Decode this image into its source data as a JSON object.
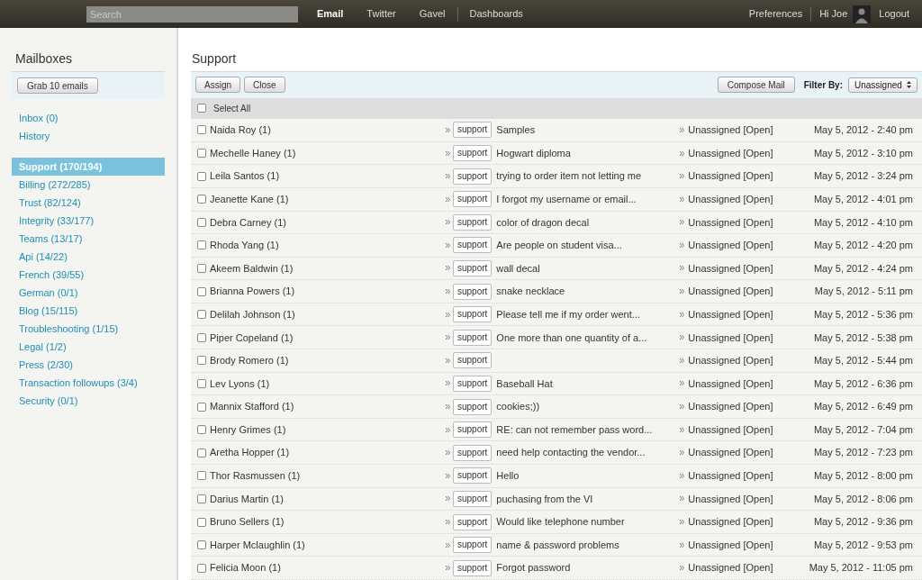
{
  "topbar": {
    "search": {
      "placeholder": "Search"
    },
    "nav": [
      {
        "label": "Email",
        "selected": true
      },
      {
        "label": "Twitter",
        "selected": false
      },
      {
        "label": "Gavel",
        "selected": false
      },
      {
        "label": "Dashboards",
        "selected": false
      }
    ],
    "preferences": "Preferences",
    "greeting": "Hi Joe",
    "logout": "Logout"
  },
  "sidebar": {
    "title": "Mailboxes",
    "grab_button": "Grab 10 emails",
    "top_items": [
      {
        "label": "Inbox (0)"
      },
      {
        "label": "History"
      }
    ],
    "mailboxes": [
      {
        "label": "Support (170/194)",
        "selected": true
      },
      {
        "label": "Billing (272/285)",
        "selected": false
      },
      {
        "label": "Trust (82/124)",
        "selected": false
      },
      {
        "label": "Integrity (33/177)",
        "selected": false
      },
      {
        "label": "Teams (13/17)",
        "selected": false
      },
      {
        "label": "Api (14/22)",
        "selected": false
      },
      {
        "label": "French (39/55)",
        "selected": false
      },
      {
        "label": "German (0/1)",
        "selected": false
      },
      {
        "label": "Blog (15/115)",
        "selected": false
      },
      {
        "label": "Troubleshooting (1/15)",
        "selected": false
      },
      {
        "label": "Legal (1/2)",
        "selected": false
      },
      {
        "label": "Press (2/30)",
        "selected": false
      },
      {
        "label": "Transaction followups (3/4)",
        "selected": false
      },
      {
        "label": "Security (0/1)",
        "selected": false
      }
    ]
  },
  "main": {
    "title": "Support",
    "buttons": [
      "Assign",
      "Close"
    ],
    "compose_button": "Compose Mail",
    "filter_label": "Filter By:",
    "filter_value": "Unassigned",
    "select_all": {
      "label": "Select All",
      "checked": false
    },
    "rows": [
      {
        "name": "Naida Roy (1)",
        "tag": "support",
        "subject": "Samples",
        "status": "Unassigned [Open]",
        "date": "May 5, 2012 - 2:40 pm",
        "checked": false
      },
      {
        "name": "Mechelle Haney (1)",
        "tag": "support",
        "subject": "Hogwart diploma",
        "status": "Unassigned [Open]",
        "date": "May 5, 2012 - 3:10 pm",
        "checked": false
      },
      {
        "name": "Leila Santos (1)",
        "tag": "support",
        "subject": "trying to order item not letting me",
        "status": "Unassigned [Open]",
        "date": "May 5, 2012 - 3:24 pm",
        "checked": false
      },
      {
        "name": "Jeanette Kane (1)",
        "tag": "support",
        "subject": "I forgot my username or email...",
        "status": "Unassigned [Open]",
        "date": "May 5, 2012 - 4:01 pm",
        "checked": false
      },
      {
        "name": "Debra Carney (1)",
        "tag": "support",
        "subject": "color of dragon decal",
        "status": "Unassigned [Open]",
        "date": "May 5, 2012 - 4:10 pm",
        "checked": false
      },
      {
        "name": "Rhoda Yang (1)",
        "tag": "support",
        "subject": "Are people on student visa...",
        "status": "Unassigned [Open]",
        "date": "May 5, 2012 - 4:20 pm",
        "checked": false
      },
      {
        "name": "Akeem Baldwin (1)",
        "tag": "support",
        "subject": "wall decal",
        "status": "Unassigned [Open]",
        "date": "May 5, 2012 - 4:24 pm",
        "checked": false
      },
      {
        "name": "Brianna Powers (1)",
        "tag": "support",
        "subject": "snake necklace",
        "status": "Unassigned [Open]",
        "date": "May 5, 2012 - 5:11 pm",
        "checked": false
      },
      {
        "name": "Delilah Johnson (1)",
        "tag": "support",
        "subject": "Please tell me if my order went...",
        "status": "Unassigned [Open]",
        "date": "May 5, 2012 - 5:36 pm",
        "checked": false
      },
      {
        "name": "Piper Copeland (1)",
        "tag": "support",
        "subject": "One more than one quantity of a...",
        "status": "Unassigned [Open]",
        "date": "May 5, 2012 - 5:38 pm",
        "checked": false
      },
      {
        "name": "Brody Romero (1)",
        "tag": "support",
        "status": "Unassigned [Open]",
        "date": "May 5, 2012 - 5:44 pm",
        "checked": false
      },
      {
        "name": "Lev Lyons (1)",
        "tag": "support",
        "subject": "Baseball Hat",
        "status": "Unassigned [Open]",
        "date": "May 5, 2012 - 6:36 pm",
        "checked": false
      },
      {
        "name": "Mannix Stafford (1)",
        "tag": "support",
        "subject": "cookies;))",
        "status": "Unassigned [Open]",
        "date": "May 5, 2012 - 6:49 pm",
        "checked": false
      },
      {
        "name": "Henry Grimes (1)",
        "tag": "support",
        "subject": "RE: can not remember pass word...",
        "status": "Unassigned [Open]",
        "date": "May 5, 2012 - 7:04 pm",
        "checked": false
      },
      {
        "name": "Aretha Hopper (1)",
        "tag": "support",
        "subject": "need help contacting the vendor...",
        "status": "Unassigned [Open]",
        "date": "May 5, 2012 - 7:23 pm",
        "checked": false
      },
      {
        "name": "Thor Rasmussen (1)",
        "tag": "support",
        "subject": "Hello",
        "status": "Unassigned [Open]",
        "date": "May 5, 2012 - 8:00 pm",
        "checked": false
      },
      {
        "name": "Darius Martin (1)",
        "tag": "support",
        "subject": "puchasing from the VI",
        "status": "Unassigned [Open]",
        "date": "May 5, 2012 - 8:06 pm",
        "checked": false
      },
      {
        "name": "Bruno Sellers (1)",
        "tag": "support",
        "subject": "Would like telephone number",
        "status": "Unassigned [Open]",
        "date": "May 5, 2012 - 9:36 pm",
        "checked": false
      },
      {
        "name": "Harper Mclaughlin (1)",
        "tag": "support",
        "subject": "name & password problems",
        "status": "Unassigned [Open]",
        "date": "May 5, 2012 - 9:53 pm",
        "checked": false
      },
      {
        "name": "Felicia Moon (1)",
        "tag": "support",
        "subject": "Forgot password",
        "status": "Unassigned [Open]",
        "date": "May 5, 2012 - 11:05 pm",
        "checked": false
      }
    ]
  }
}
